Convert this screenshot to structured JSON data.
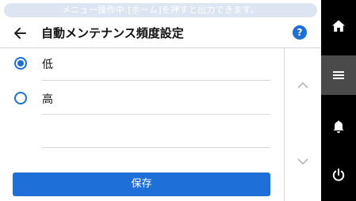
{
  "banner": {
    "text": "メニュー操作中:[ホーム]を押すと出力できます。"
  },
  "header": {
    "title": "自動メンテナンス頻度設定",
    "help_label": "?"
  },
  "options": [
    {
      "label": "低",
      "selected": true
    },
    {
      "label": "高",
      "selected": false
    }
  ],
  "save_label": "保存",
  "sidebar": {
    "items": [
      {
        "icon": "home-icon"
      },
      {
        "icon": "menu-icon",
        "active": true
      },
      {
        "icon": "bell-icon"
      },
      {
        "icon": "power-icon"
      }
    ]
  },
  "colors": {
    "accent": "#1f6fd9",
    "sidebar_bg": "#000000",
    "sidebar_active": "#4a4a4a",
    "banner_bg": "#dde5f2"
  }
}
